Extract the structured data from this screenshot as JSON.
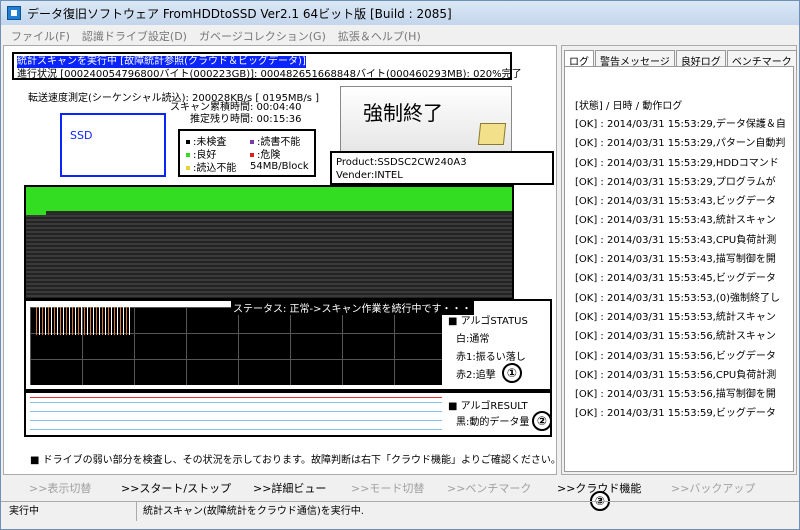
{
  "window": {
    "title": "データ復旧ソフトウェア FromHDDtoSSD Ver2.1 64ビット版 [Build : 2085]"
  },
  "menu": [
    "ファイル(F)",
    "認識ドライブ設定(D)",
    "ガベージコレクション(G)",
    "拡張＆ヘルプ(H)"
  ],
  "scan": {
    "status": "統計スキャンを実行中 [故障統計参照(クラウド＆ビッグデータ)]",
    "progress": "進行状況 [000240054796800バイト(000223GB)]: 000482651668848バイト(000460293MB): 020%完了",
    "speed": "転送速度測定(シーケンシャル読込): 200028KB/s [ 0195MB/s ]",
    "elapsed": "スキャン累積時間: 00:04:40",
    "remaining": "推定残り時間: 00:15:36"
  },
  "drive": {
    "name": "SSD",
    "product": "Product:SSDSC2CW240A3",
    "vender": "Vender:INTEL"
  },
  "legend": {
    "unchecked": "未検査",
    "unreadable": "読書不能",
    "good": "良好",
    "danger": "危険",
    "readfail": "読込不能",
    "block": "54MB/Block",
    "colors": {
      "unchecked": "#000000",
      "unreadable": "#7a3aa8",
      "good": "#33dd22",
      "danger": "#e02020",
      "readfail": "#e8d23a"
    }
  },
  "force_stop": {
    "label": "強制終了"
  },
  "monitor": {
    "status": "ステータス: 正常->スキャン作業を続行中です・・・",
    "algo_status": "■ アルゴSTATUS",
    "normal": "白:通常",
    "swing": "赤1:振るい落し",
    "chase": "赤2:追撃",
    "num": "①"
  },
  "result": {
    "algo_result": "■ アルゴRESULT",
    "black": "黒:動的データ量",
    "num": "②"
  },
  "note": "■ ドライブの弱い部分を検査し、その状況を示しております。故障判断は右下「クラウド機能」よりご確認ください。",
  "tabs": [
    "ログ",
    "警告メッセージ",
    "良好ログ",
    "ベンチマーク"
  ],
  "log": {
    "header": "[状態] / 日時 / 動作ログ",
    "rows": [
      "[OK] : 2014/03/31 15:53:29,データ保護＆自",
      "[OK] : 2014/03/31 15:53:29,パターン自動判",
      "[OK] : 2014/03/31 15:53:29,HDDコマンド",
      "[OK] : 2014/03/31 15:53:29,プログラムが",
      "[OK] : 2014/03/31 15:53:43,ビッグデータ",
      "[OK] : 2014/03/31 15:53:43,統計スキャン",
      "[OK] : 2014/03/31 15:53:43,CPU負荷計測",
      "[OK] : 2014/03/31 15:53:43,描写制御を開",
      "[OK] : 2014/03/31 15:53:45,ビッグデータ",
      "[OK] : 2014/03/31 15:53:53,(0)強制終了し",
      "[OK] : 2014/03/31 15:53:53,統計スキャン",
      "[OK] : 2014/03/31 15:53:56,統計スキャン",
      "[OK] : 2014/03/31 15:53:56,ビッグデータ",
      "[OK] : 2014/03/31 15:53:56,CPU負荷計測",
      "[OK] : 2014/03/31 15:53:56,描写制御を開",
      "[OK] : 2014/03/31 15:53:59,ビッグデータ"
    ]
  },
  "bottom": {
    "display_switch": ">>表示切替",
    "start_stop": ">>スタート/ストップ",
    "detail_view": ">>詳細ビュー",
    "mode_switch": ">>モード切替",
    "benchmark": ">>ベンチマーク",
    "cloud": ">>クラウド機能",
    "cloud_num": "③",
    "backup": ">>バックアップ"
  },
  "statusbar": {
    "left": "実行中",
    "right": "統計スキャン(故障統計をクラウド通信)を実行中."
  }
}
